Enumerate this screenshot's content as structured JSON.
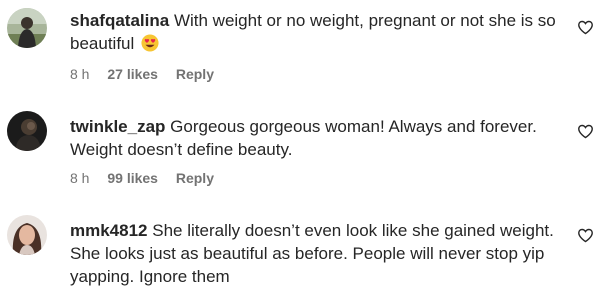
{
  "comments": [
    {
      "username": "shafqatalina",
      "text": "With weight or no weight, pregnant or not she is so beautiful",
      "emoji": "smiling-face-with-heart-eyes",
      "time": "8 h",
      "likes": "27 likes",
      "reply": "Reply",
      "avatar": "avatar-outdoor-photo"
    },
    {
      "username": "twinkle_zap",
      "text": "Gorgeous gorgeous woman! Always and forever. Weight doesn’t define beauty.",
      "time": "8 h",
      "likes": "99 likes",
      "reply": "Reply",
      "avatar": "avatar-dark-photo"
    },
    {
      "username": "mmk4812",
      "text": "She literally doesn’t even look like she gained weight. She looks just as beautiful as before. People will never stop yip yapping. Ignore them",
      "avatar": "avatar-portrait-photo"
    }
  ],
  "icons": {
    "like": "heart-outline-icon"
  },
  "colors": {
    "text": "#262626",
    "meta": "#737373",
    "background": "#ffffff"
  }
}
